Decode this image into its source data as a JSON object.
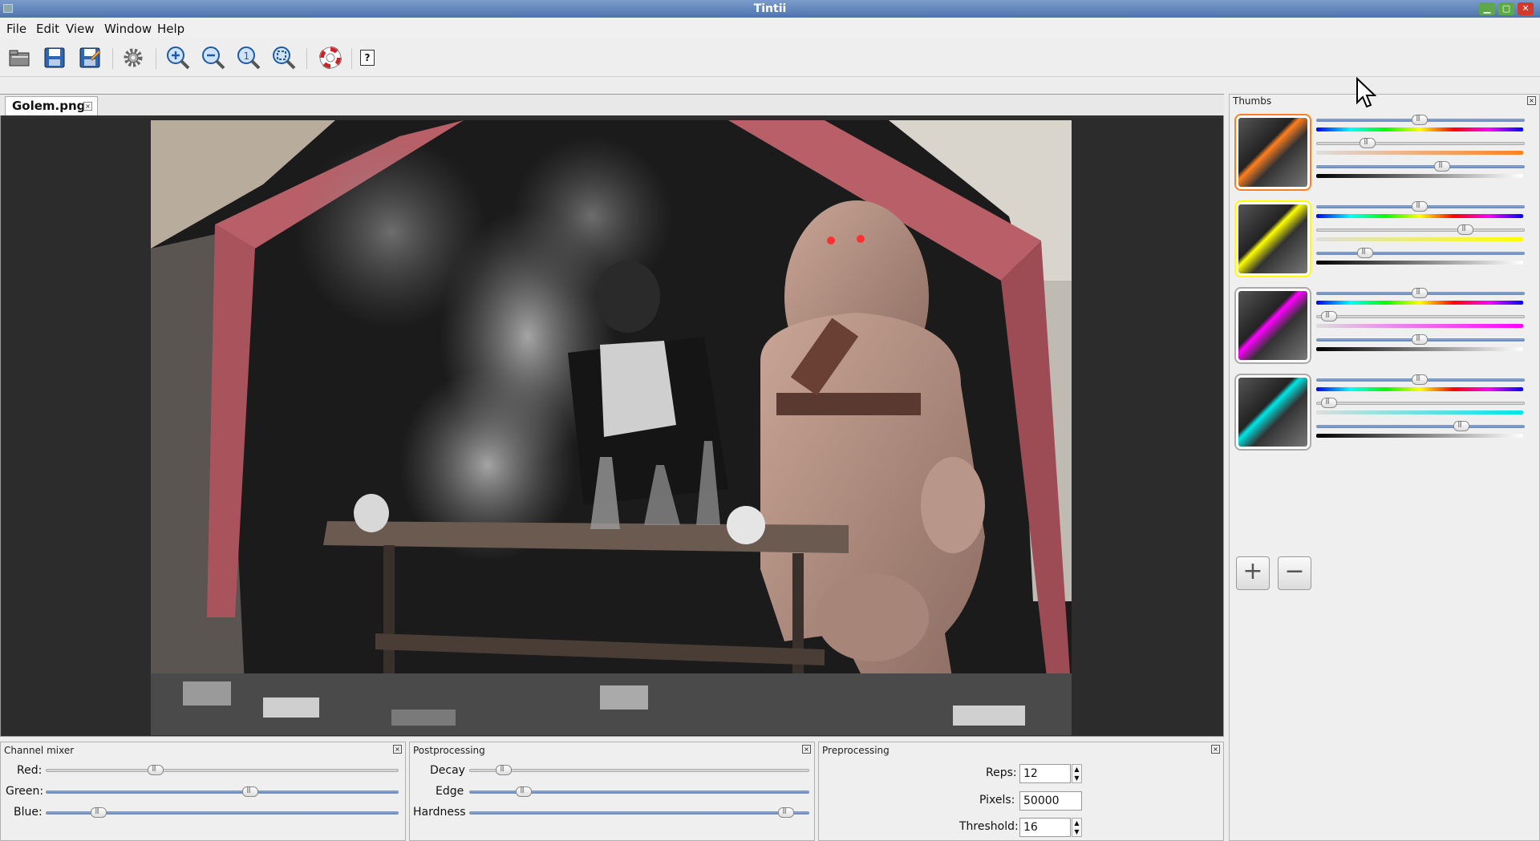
{
  "window": {
    "title": "Tintii"
  },
  "menu": [
    "File",
    "Edit",
    "View",
    "Window",
    "Help"
  ],
  "toolbar": {
    "icons": [
      "open-icon",
      "save-icon",
      "save-as-icon",
      "settings-icon",
      "zoom-in-icon",
      "zoom-out-icon",
      "zoom-100-icon",
      "zoom-fit-icon",
      "help-lifebuoy-icon",
      "about-icon"
    ],
    "about_label": "?"
  },
  "document": {
    "tab_label": "Golem.png",
    "tab_close": "×"
  },
  "channel_mixer": {
    "title": "Channel mixer",
    "red_label": "Red:",
    "red_value": 0.3,
    "green_label": "Green:",
    "green_value": 0.58,
    "blue_label": "Blue:",
    "blue_value": 0.13
  },
  "postprocessing": {
    "title": "Postprocessing",
    "decay_label": "Decay",
    "decay_value": 0.08,
    "edge_label": "Edge",
    "edge_value": 0.14,
    "hardness_label": "Hardness",
    "hardness_value": 0.95
  },
  "preprocessing": {
    "title": "Preprocessing",
    "reps_label": "Reps:",
    "reps_value": "12",
    "pixels_label": "Pixels:",
    "pixels_value": "50000",
    "threshold_label": "Threshold:",
    "threshold_value": "16"
  },
  "thumbs": {
    "title": "Thumbs",
    "items": [
      {
        "color": "#ff7f1e",
        "sliders": [
          0.49,
          0.22,
          0.61
        ]
      },
      {
        "color": "#ffff00",
        "sliders": [
          0.49,
          0.73,
          0.21
        ]
      },
      {
        "color": "#ff00ff",
        "sliders": [
          0.49,
          0.02,
          0.49
        ]
      },
      {
        "color": "#00e6e6",
        "sliders": [
          0.49,
          0.02,
          0.71
        ]
      }
    ],
    "add_label": "+",
    "remove_label": "−"
  },
  "close_glyph": "×"
}
